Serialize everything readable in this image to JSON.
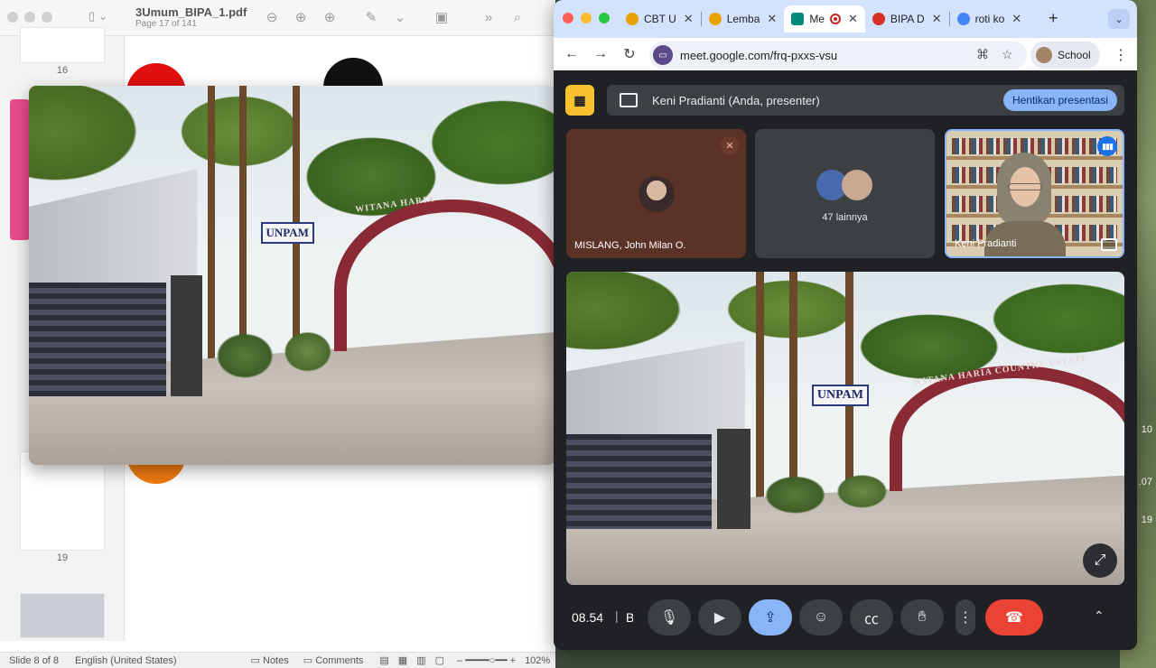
{
  "desktop": {
    "numbers": [
      "10",
      ".07",
      "19"
    ]
  },
  "pdf_app": {
    "filename": "3Umum_BIPA_1.pdf",
    "page_info": "Page 17 of 141",
    "thumbnails": [
      {
        "number": "16"
      },
      {
        "number": "19"
      }
    ],
    "status_bar": {
      "slide": "Slide 8 of 8",
      "language": "English (United States)",
      "notes": "Notes",
      "comments": "Comments",
      "zoom": "102%"
    }
  },
  "pip_video": {
    "sign_text": "UNPAM",
    "arch_text": "WITANA HARIA"
  },
  "chrome": {
    "tabs": [
      {
        "label": "CBT U",
        "favicon_color": "#e8a200",
        "active": false
      },
      {
        "label": "Lemba",
        "favicon_color": "#e8a200",
        "active": false
      },
      {
        "label": "Me",
        "favicon_color": "#00897b",
        "active": true,
        "recording": true
      },
      {
        "label": "BIPA D",
        "favicon_color": "#d93025",
        "active": false
      },
      {
        "label": "roti ko",
        "favicon_color": "#4285f4",
        "active": false
      }
    ],
    "url": "meet.google.com/frq-pxxs-vsu",
    "profile_label": "School"
  },
  "meet": {
    "presenter_banner": "Keni Pradianti (Anda, presenter)",
    "stop_presenting": "Hentikan presentasi",
    "tiles": {
      "participant_1": "MISLANG, John Milan O.",
      "others_count": "47 lainnya",
      "self_name": "Keni Pradianti"
    },
    "stage": {
      "sign_text": "UNPAM",
      "arch_text": "WITANA HARIA COUNTRY ESTATE"
    },
    "controls": {
      "time": "08.54",
      "separator": "|",
      "meeting_code_initial": "B"
    }
  }
}
